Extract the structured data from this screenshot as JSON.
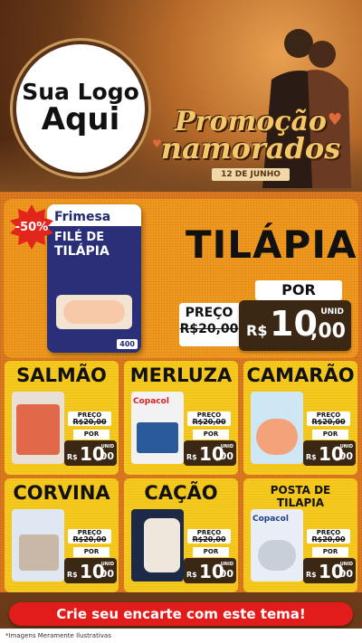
{
  "header": {
    "logo_line1": "Sua Logo",
    "logo_line2": "Aqui",
    "promo_line1": "Promoção",
    "promo_line2": "namorados",
    "promo_date": "12 DE JUNHO"
  },
  "hero": {
    "badge": "-50%",
    "brand": "Frimesa",
    "package_line1": "FILÉ DE",
    "package_line2": "TILÁPIA",
    "package_weight": "400",
    "title": "TILÁPIA",
    "por_label": "POR",
    "preco_label": "PREÇO",
    "old_price": "R$20,00",
    "currency": "R$",
    "price_int": "10",
    "price_dec": ",00",
    "unit": "UNID"
  },
  "cards": [
    {
      "name": "SALMÃO",
      "preco_label": "PREÇO",
      "old_price": "R$20,00",
      "por_label": "POR",
      "currency": "R$",
      "price_int": "10",
      "price_dec": ",00",
      "unit": "UNID",
      "product_color": "#e8e0d6"
    },
    {
      "name": "MERLUZA",
      "preco_label": "PREÇO",
      "old_price": "R$20,00",
      "por_label": "POR",
      "currency": "R$",
      "price_int": "10",
      "price_dec": ",00",
      "unit": "UNID",
      "product_color": "#f2f2f2",
      "product_brand": "Copacol"
    },
    {
      "name": "CAMARÃO",
      "preco_label": "PREÇO",
      "old_price": "R$20,00",
      "por_label": "POR",
      "currency": "R$",
      "price_int": "10",
      "price_dec": ",00",
      "unit": "UNID",
      "product_color": "#cfe6f4"
    },
    {
      "name": "CORVINA",
      "preco_label": "PREÇO",
      "old_price": "R$20,00",
      "por_label": "POR",
      "currency": "R$",
      "price_int": "10",
      "price_dec": ",00",
      "unit": "UNID",
      "product_color": "#dfe8f2"
    },
    {
      "name": "CAÇÃO",
      "preco_label": "PREÇO",
      "old_price": "R$20,00",
      "por_label": "POR",
      "currency": "R$",
      "price_int": "10",
      "price_dec": ",00",
      "unit": "UNID",
      "product_color": "#1c2a48"
    },
    {
      "name": "POSTA DE TILAPIA",
      "preco_label": "PREÇO",
      "old_price": "R$20,00",
      "por_label": "POR",
      "currency": "R$",
      "price_int": "10",
      "price_dec": ",00",
      "unit": "UNID",
      "product_color": "#e9eef6",
      "product_brand": "Copacol"
    }
  ],
  "footer": {
    "cta": "Crie seu encarte com este tema!",
    "note": "*Imagens Meramente Ilustrativas"
  },
  "colors": {
    "hero_bg": "#f39a1e",
    "card_bg": "#f6c91c",
    "price_bg": "#3a2714",
    "cta_bg": "#e21b1b",
    "badge_bg": "#e2261b"
  }
}
